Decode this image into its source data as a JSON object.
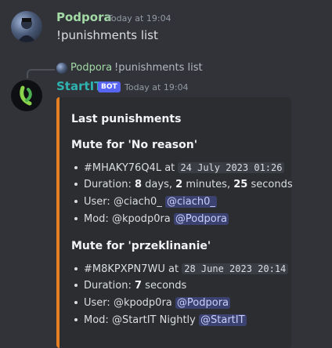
{
  "message1": {
    "author": "Podpora",
    "timestamp": "Today at 19:04",
    "content": "!punishments list"
  },
  "reply": {
    "author": "Podpora",
    "content": "!punishments list"
  },
  "message2": {
    "author": "StartIT",
    "bot_tag": "BOT",
    "timestamp": "Today at 19:04",
    "embed": {
      "accent_color": "#e67e22",
      "title": "Last punishments",
      "fields": [
        {
          "name": "Mute for 'No reason'",
          "id": "#MHAKY76Q4L",
          "at_label": "at",
          "date": "24 July 2023 01:26",
          "duration_label": "Duration:",
          "duration_days": "8",
          "duration_days_unit": "days,",
          "duration_minutes": "2",
          "duration_minutes_unit": "minutes,",
          "duration_seconds": "25",
          "duration_seconds_unit": "seconds",
          "user_label": "User:",
          "user_name": "@ciach0_",
          "user_mention": "@ciach0_",
          "mod_label": "Mod:",
          "mod_name": "@kpodp0ra",
          "mod_mention": "@Podpora"
        },
        {
          "name": "Mute for 'przeklinanie'",
          "id": "#M8KPXPN7WU",
          "at_label": "at",
          "date": "28 June 2023 20:14",
          "duration_label": "Duration:",
          "duration_seconds": "7",
          "duration_seconds_unit": "seconds",
          "user_label": "User:",
          "user_name": "@kpodp0ra",
          "user_mention": "@Podpora",
          "mod_label": "Mod:",
          "mod_name": "@StartIT Nightly",
          "mod_mention": "@StartIT"
        }
      ]
    }
  },
  "colors": {
    "background": "#313338",
    "embed_background": "#2b2d31",
    "podpora_name": "#a3d9a5",
    "startit_name": "#2fb3b0",
    "bot_tag": "#5865f2",
    "mention_bg": "#3c4270"
  }
}
